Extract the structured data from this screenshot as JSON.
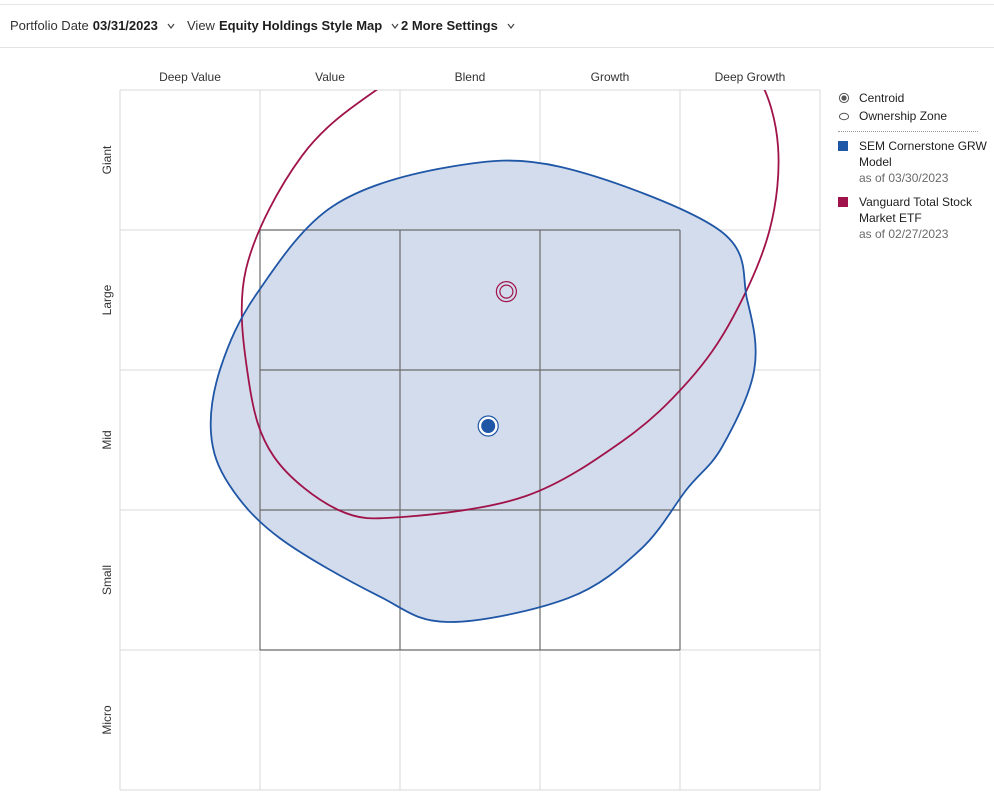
{
  "toolbar": {
    "portfolio_date_label": "Portfolio Date",
    "portfolio_date_value": "03/31/2023",
    "view_label": "View",
    "view_value": "Equity Holdings Style Map",
    "more_settings": "2 More Settings"
  },
  "legend": {
    "centroid": "Centroid",
    "ownership_zone": "Ownership Zone",
    "series": [
      {
        "name": "SEM Cornerstone GRW Model",
        "line1": "SEM Cornerstone GRW",
        "line2": "Model",
        "as_of": "as of 03/30/2023",
        "color": "#1f56a6"
      },
      {
        "name": "Vanguard Total Stock Market ETF",
        "line1": "Vanguard Total Stock",
        "line2": "Market ETF",
        "as_of": "as of 02/27/2023",
        "color": "#a0134a"
      }
    ]
  },
  "chart_data": {
    "type": "scatter",
    "title": "",
    "x_categories": [
      "Deep Value",
      "Value",
      "Blend",
      "Growth",
      "Deep Growth"
    ],
    "y_categories": [
      "Giant",
      "Large",
      "Mid",
      "Small",
      "Micro"
    ],
    "xlim": [
      0,
      5
    ],
    "ylim": [
      0,
      5
    ],
    "grid": true,
    "highlighted_box": {
      "x": [
        1,
        4
      ],
      "y": [
        1,
        4
      ]
    },
    "legend_position": "right",
    "series": [
      {
        "name": "SEM Cornerstone GRW Model",
        "color": "#1f56a6",
        "fill": "#d3dcec",
        "centroid": {
          "x": 2.63,
          "y": 2.6
        },
        "ownership_zone": [
          [
            2.34,
            1.2
          ],
          [
            1.84,
            1.39
          ],
          [
            1.14,
            1.8
          ],
          [
            0.78,
            2.18
          ],
          [
            0.65,
            2.55
          ],
          [
            0.72,
            3.02
          ],
          [
            0.98,
            3.55
          ],
          [
            1.52,
            4.17
          ],
          [
            2.35,
            4.45
          ],
          [
            3.15,
            4.45
          ],
          [
            4.28,
            4.0
          ],
          [
            4.48,
            3.5
          ],
          [
            4.53,
            3.0
          ],
          [
            4.3,
            2.45
          ],
          [
            4.05,
            2.15
          ],
          [
            3.72,
            1.72
          ],
          [
            3.2,
            1.37
          ]
        ]
      },
      {
        "name": "Vanguard Total Stock Market ETF",
        "color": "#a0134a",
        "fill": "none",
        "centroid": {
          "x": 2.76,
          "y": 3.56
        },
        "ownership_zone": [
          [
            2.02,
            1.95
          ],
          [
            1.56,
            2.0
          ],
          [
            1.1,
            2.38
          ],
          [
            0.92,
            2.92
          ],
          [
            0.9,
            3.72
          ],
          [
            1.3,
            4.53
          ],
          [
            1.86,
            5.02
          ],
          [
            2.55,
            5.4
          ],
          [
            3.4,
            5.45
          ],
          [
            4.26,
            5.25
          ],
          [
            4.56,
            5.08
          ],
          [
            4.7,
            4.6
          ],
          [
            4.64,
            4.0
          ],
          [
            4.38,
            3.38
          ],
          [
            4.06,
            2.92
          ],
          [
            3.6,
            2.5
          ],
          [
            2.9,
            2.1
          ]
        ]
      }
    ]
  }
}
